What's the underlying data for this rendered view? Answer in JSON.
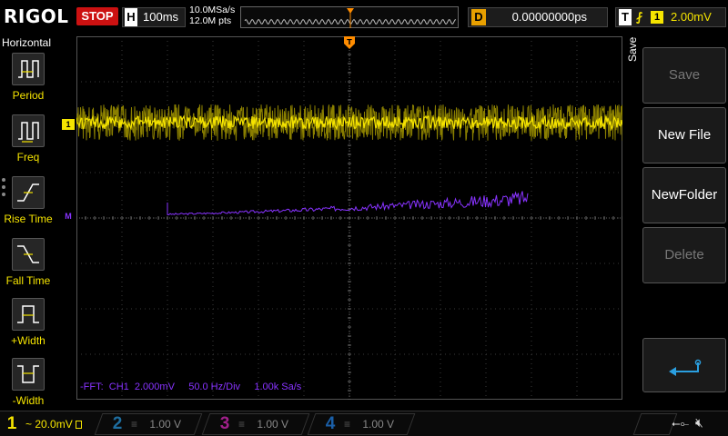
{
  "topbar": {
    "brand": "RIGOL",
    "run_state": "STOP",
    "horizontal": {
      "label": "H",
      "timebase": "100ms"
    },
    "sample_rate": "10.0MSa/s",
    "memory_depth": "12.0M pts",
    "delay": {
      "label": "D",
      "value": "0.00000000ps"
    },
    "trigger": {
      "label": "T",
      "edge_symbol": "⨏",
      "source": "1",
      "level": "2.00mV"
    }
  },
  "left_menu": {
    "title": "Horizontal",
    "items": [
      {
        "label": "Period",
        "icon": "period-icon"
      },
      {
        "label": "Freq",
        "icon": "frequency-icon"
      },
      {
        "label": "Rise Time",
        "icon": "rise-time-icon"
      },
      {
        "label": "Fall Time",
        "icon": "fall-time-icon"
      },
      {
        "label": "+Width",
        "icon": "positive-width-icon"
      },
      {
        "label": "-Width",
        "icon": "negative-width-icon"
      }
    ]
  },
  "display": {
    "ch1_marker": "1",
    "math_marker": "M",
    "fft_info": "-FFT:  CH1  2.000mV     50.0 Hz/Div     1.00k Sa/s"
  },
  "right_menu": {
    "title": "Save",
    "buttons": [
      {
        "label": "Save",
        "enabled": false
      },
      {
        "label": "New File",
        "enabled": true
      },
      {
        "label": "NewFolder",
        "enabled": true
      },
      {
        "label": "Delete",
        "enabled": false
      }
    ],
    "enter_icon": "enter-icon"
  },
  "channels": [
    {
      "number": "1",
      "coupling_symbol": "~",
      "scale": "20.0mV",
      "active": true
    },
    {
      "number": "2",
      "scale": "1.00 V",
      "active": false
    },
    {
      "number": "3",
      "scale": "1.00 V",
      "active": false
    },
    {
      "number": "4",
      "scale": "1.00 V",
      "active": false
    }
  ],
  "status_icons": [
    "usb-icon",
    "speaker-muted-icon"
  ],
  "colors": {
    "ch1": "#f5e400",
    "math": "#8833ff",
    "stop": "#cc1111",
    "delay": "#e8a000",
    "trigger_marker": "#ff8c00"
  }
}
